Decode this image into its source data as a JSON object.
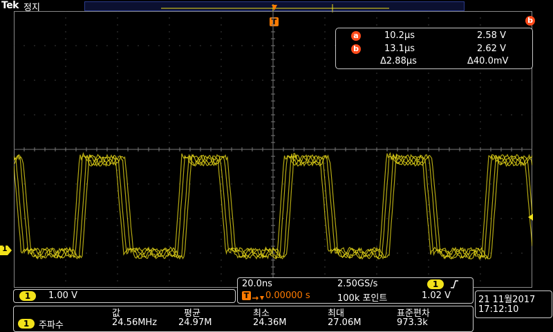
{
  "top": {
    "brand": "Tek",
    "run_state": "정지"
  },
  "trigger_marker": "T",
  "ch1_marker": "1",
  "cursor_corner_badge": "b",
  "cursors": {
    "a": {
      "badge": "a",
      "time": "10.2µs",
      "volt": "2.58 V"
    },
    "b": {
      "badge": "b",
      "time": "13.1µs",
      "volt": "2.62 V"
    },
    "delta_time": "Δ2.88µs",
    "delta_volt": "Δ40.0mV"
  },
  "channel": {
    "badge": "1",
    "scale": "1.00 V"
  },
  "acquisition": {
    "timebase": "20.0ns",
    "sample_rate": "2.50GS/s",
    "trigger_badge": "1",
    "trigger_slope_icon": "rising-edge-icon",
    "trigger_t": "T",
    "trigger_delay": "0.00000 s",
    "record_length": "100k 포인트",
    "trigger_level": "1.02 V"
  },
  "datetime": {
    "date": "21 11월2017",
    "time": "17:12:10"
  },
  "measurement": {
    "source_badge": "1",
    "name": "주파수",
    "headers": [
      "값",
      "평균",
      "최소",
      "최대",
      "표준편차"
    ],
    "values": [
      "24.56MHz",
      "24.97M",
      "24.36M",
      "27.06M",
      "973.3k"
    ]
  },
  "colors": {
    "trace": "#f2e21a",
    "accent": "#ff4a1a",
    "trigger": "#ff7b00",
    "grid": "#7a7a7a"
  }
}
